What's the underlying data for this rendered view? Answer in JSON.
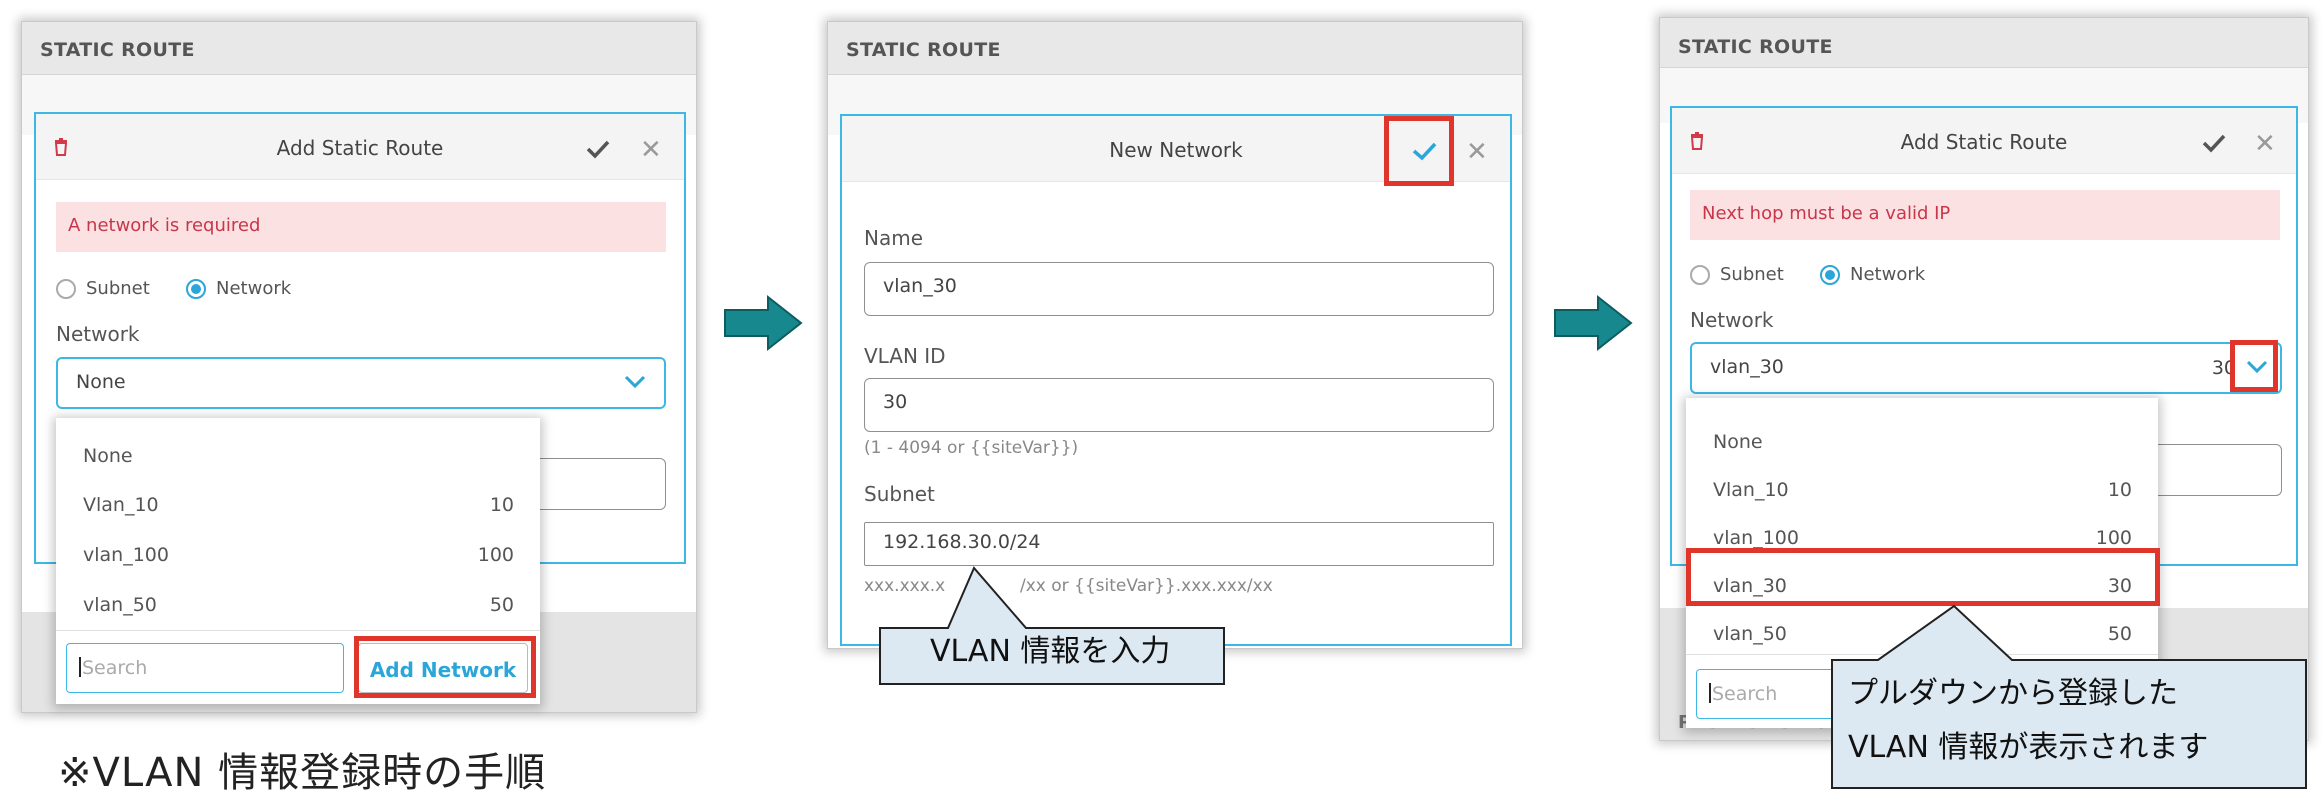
{
  "panels": [
    {
      "header": "STATIC ROUTE",
      "modal_title": "Add Static Route",
      "alert": "A network is required",
      "radio_subnet": "Subnet",
      "radio_network": "Network",
      "network_label": "Network",
      "network_value": "None",
      "dropdown_items": [
        {
          "name": "None",
          "value": ""
        },
        {
          "name": "Vlan_10",
          "value": "10"
        },
        {
          "name": "vlan_100",
          "value": "100"
        },
        {
          "name": "vlan_50",
          "value": "50"
        }
      ],
      "search_placeholder": "Search",
      "add_network": "Add Network"
    },
    {
      "header": "STATIC ROUTE",
      "modal_title": "New Network",
      "name_label": "Name",
      "name_value": "vlan_30",
      "vlan_label": "VLAN ID",
      "vlan_value": "30",
      "vlan_hint": "(1 - 4094 or {{siteVar}})",
      "subnet_label": "Subnet",
      "subnet_value": "192.168.30.0/24",
      "subnet_hint_left": "xxx.xxx.x",
      "subnet_hint_right": "/xx or {{siteVar}}.xxx.xxx/xx"
    },
    {
      "header": "STATIC ROUTE",
      "modal_title": "Add Static Route",
      "alert": "Next hop must be a valid IP",
      "radio_subnet": "Subnet",
      "radio_network": "Network",
      "network_label": "Network",
      "network_value": "vlan_30",
      "network_num": "30",
      "dropdown_items": [
        {
          "name": "None",
          "value": ""
        },
        {
          "name": "Vlan_10",
          "value": "10"
        },
        {
          "name": "vlan_100",
          "value": "100"
        },
        {
          "name": "vlan_30",
          "value": "30"
        },
        {
          "name": "vlan_50",
          "value": "50"
        }
      ],
      "search_placeholder": "Search",
      "background_label": "PROTECTION O"
    }
  ],
  "callouts": {
    "middle": "VLAN 情報を入力",
    "right_line1": "プルダウンから登録した",
    "right_line2": "VLAN 情報が表示されます"
  },
  "note": "※VLAN 情報登録時の手順",
  "colors": {
    "accent": "#3db8e5",
    "highlight_red": "#e0352b",
    "arrow": "#17888e",
    "callout_fill": "#dce9f2",
    "alert_bg": "#fce1e3"
  }
}
